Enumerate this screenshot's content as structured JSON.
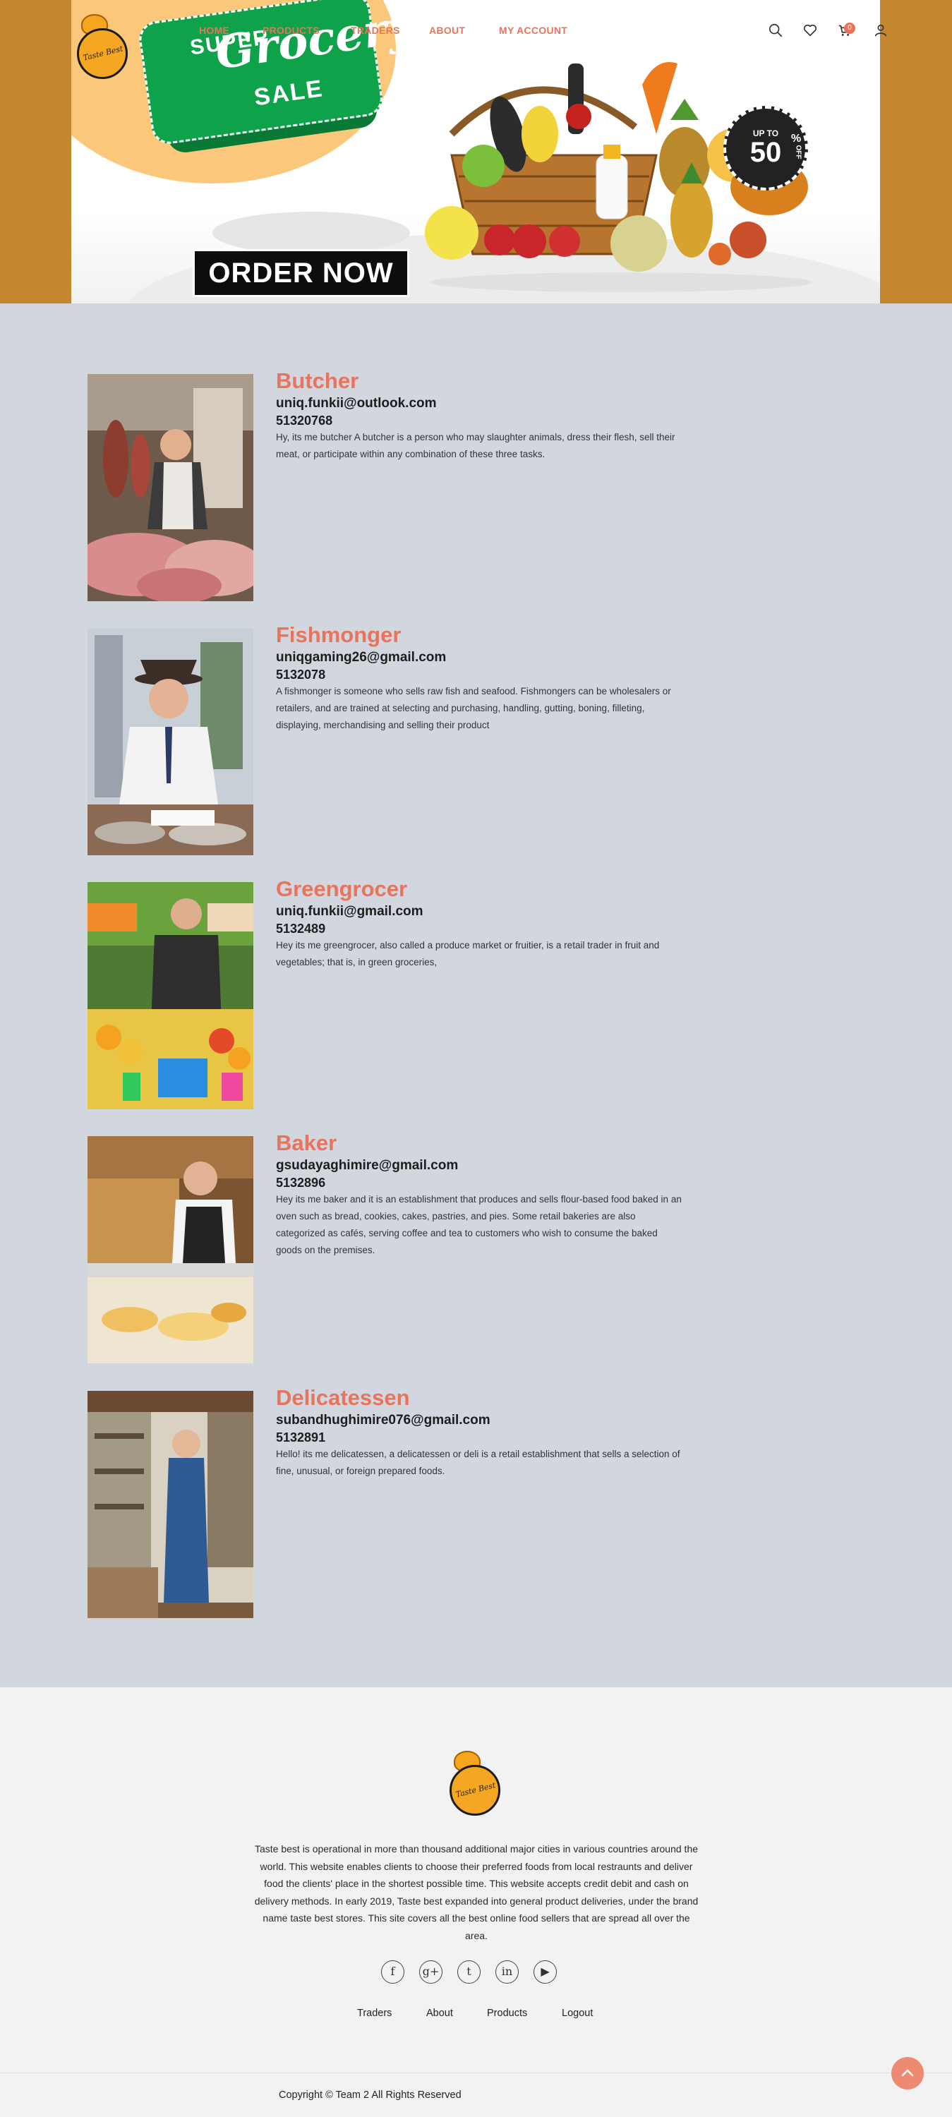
{
  "header": {
    "logo_text": "Taste Best",
    "nav": [
      {
        "label": "HOME"
      },
      {
        "label": "PRODUCTS"
      },
      {
        "label": "TRADERS"
      },
      {
        "label": "ABOUT"
      },
      {
        "label": "MY ACCOUNT"
      }
    ],
    "cart_count": "0",
    "icons": [
      "search-icon",
      "heart-icon",
      "cart-icon",
      "user-icon"
    ]
  },
  "hero": {
    "banner_line1": "SUPER",
    "banner_line2": "Grocery",
    "banner_line3": "SALE",
    "order_button": "ORDER NOW",
    "discount_top": "UP TO",
    "discount_value": "50",
    "discount_percent": "%",
    "discount_off": "OFF"
  },
  "traders": [
    {
      "title": "Butcher",
      "email": "uniq.funkii@outlook.com",
      "phone": "51320768",
      "description": "Hy, its me butcher A butcher is a person who may slaughter animals, dress their flesh, sell their meat, or participate within any combination of these three tasks."
    },
    {
      "title": "Fishmonger",
      "email": "uniqgaming26@gmail.com",
      "phone": "5132078",
      "description": "A fishmonger is someone who sells raw fish and seafood. Fishmongers can be wholesalers or retailers, and are trained at selecting and purchasing, handling, gutting, boning, filleting, displaying, merchandising and selling their product"
    },
    {
      "title": "Greengrocer",
      "email": "uniq.funkii@gmail.com",
      "phone": "5132489",
      "description": "Hey its me greengrocer, also called a produce market or fruitier, is a retail trader in fruit and vegetables; that is, in green groceries,"
    },
    {
      "title": "Baker",
      "email": "gsudayaghimire@gmail.com",
      "phone": "5132896",
      "description": "Hey its me baker and it is an establishment that produces and sells flour-based food baked in an oven such as bread, cookies, cakes, pastries, and pies. Some retail bakeries are also categorized as cafés, serving coffee and tea to customers who wish to consume the baked goods on the premises."
    },
    {
      "title": "Delicatessen",
      "email": "subandhughimire076@gmail.com",
      "phone": "5132891",
      "description": "Hello! its me delicatessen, a delicatessen or deli is a retail establishment that sells a selection of fine, unusual, or foreign prepared foods."
    }
  ],
  "footer": {
    "about": "Taste best is operational in more than thousand additional major cities in various countries around the world. This website enables clients to choose their preferred foods from local restraunts and deliver food the clients' place in the shortest possible time. This website accepts credit debit and cash on delivery methods. In early 2019, Taste best expanded into general product deliveries, under the brand name taste best stores. This site covers all the best online food sellers that are spread all over the area.",
    "socials": [
      {
        "name": "facebook-icon",
        "glyph": "f"
      },
      {
        "name": "google-plus-icon",
        "glyph": "g+"
      },
      {
        "name": "tumblr-icon",
        "glyph": "t"
      },
      {
        "name": "linkedin-icon",
        "glyph": "in"
      },
      {
        "name": "youtube-icon",
        "glyph": "▶"
      }
    ],
    "links": [
      {
        "label": "Traders"
      },
      {
        "label": "About"
      },
      {
        "label": "Products"
      },
      {
        "label": "Logout"
      }
    ],
    "copyright": "Copyright © Team 2 All Rights Reserved"
  },
  "colors": {
    "accent": "#e9735b",
    "side_bg": "#c4862f",
    "content_bg": "#d2d6de",
    "footer_bg": "#f2f2f2",
    "banner_green": "#0ea24a"
  }
}
